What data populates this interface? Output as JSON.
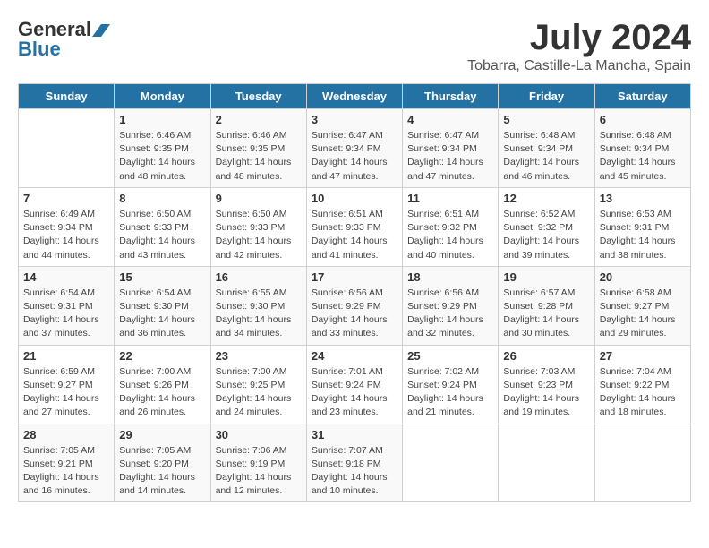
{
  "header": {
    "logo_general": "General",
    "logo_blue": "Blue",
    "month": "July 2024",
    "location": "Tobarra, Castille-La Mancha, Spain"
  },
  "weekdays": [
    "Sunday",
    "Monday",
    "Tuesday",
    "Wednesday",
    "Thursday",
    "Friday",
    "Saturday"
  ],
  "weeks": [
    [
      {
        "day": "",
        "sunrise": "",
        "sunset": "",
        "daylight": ""
      },
      {
        "day": "1",
        "sunrise": "Sunrise: 6:46 AM",
        "sunset": "Sunset: 9:35 PM",
        "daylight": "Daylight: 14 hours and 48 minutes."
      },
      {
        "day": "2",
        "sunrise": "Sunrise: 6:46 AM",
        "sunset": "Sunset: 9:35 PM",
        "daylight": "Daylight: 14 hours and 48 minutes."
      },
      {
        "day": "3",
        "sunrise": "Sunrise: 6:47 AM",
        "sunset": "Sunset: 9:34 PM",
        "daylight": "Daylight: 14 hours and 47 minutes."
      },
      {
        "day": "4",
        "sunrise": "Sunrise: 6:47 AM",
        "sunset": "Sunset: 9:34 PM",
        "daylight": "Daylight: 14 hours and 47 minutes."
      },
      {
        "day": "5",
        "sunrise": "Sunrise: 6:48 AM",
        "sunset": "Sunset: 9:34 PM",
        "daylight": "Daylight: 14 hours and 46 minutes."
      },
      {
        "day": "6",
        "sunrise": "Sunrise: 6:48 AM",
        "sunset": "Sunset: 9:34 PM",
        "daylight": "Daylight: 14 hours and 45 minutes."
      }
    ],
    [
      {
        "day": "7",
        "sunrise": "Sunrise: 6:49 AM",
        "sunset": "Sunset: 9:34 PM",
        "daylight": "Daylight: 14 hours and 44 minutes."
      },
      {
        "day": "8",
        "sunrise": "Sunrise: 6:50 AM",
        "sunset": "Sunset: 9:33 PM",
        "daylight": "Daylight: 14 hours and 43 minutes."
      },
      {
        "day": "9",
        "sunrise": "Sunrise: 6:50 AM",
        "sunset": "Sunset: 9:33 PM",
        "daylight": "Daylight: 14 hours and 42 minutes."
      },
      {
        "day": "10",
        "sunrise": "Sunrise: 6:51 AM",
        "sunset": "Sunset: 9:33 PM",
        "daylight": "Daylight: 14 hours and 41 minutes."
      },
      {
        "day": "11",
        "sunrise": "Sunrise: 6:51 AM",
        "sunset": "Sunset: 9:32 PM",
        "daylight": "Daylight: 14 hours and 40 minutes."
      },
      {
        "day": "12",
        "sunrise": "Sunrise: 6:52 AM",
        "sunset": "Sunset: 9:32 PM",
        "daylight": "Daylight: 14 hours and 39 minutes."
      },
      {
        "day": "13",
        "sunrise": "Sunrise: 6:53 AM",
        "sunset": "Sunset: 9:31 PM",
        "daylight": "Daylight: 14 hours and 38 minutes."
      }
    ],
    [
      {
        "day": "14",
        "sunrise": "Sunrise: 6:54 AM",
        "sunset": "Sunset: 9:31 PM",
        "daylight": "Daylight: 14 hours and 37 minutes."
      },
      {
        "day": "15",
        "sunrise": "Sunrise: 6:54 AM",
        "sunset": "Sunset: 9:30 PM",
        "daylight": "Daylight: 14 hours and 36 minutes."
      },
      {
        "day": "16",
        "sunrise": "Sunrise: 6:55 AM",
        "sunset": "Sunset: 9:30 PM",
        "daylight": "Daylight: 14 hours and 34 minutes."
      },
      {
        "day": "17",
        "sunrise": "Sunrise: 6:56 AM",
        "sunset": "Sunset: 9:29 PM",
        "daylight": "Daylight: 14 hours and 33 minutes."
      },
      {
        "day": "18",
        "sunrise": "Sunrise: 6:56 AM",
        "sunset": "Sunset: 9:29 PM",
        "daylight": "Daylight: 14 hours and 32 minutes."
      },
      {
        "day": "19",
        "sunrise": "Sunrise: 6:57 AM",
        "sunset": "Sunset: 9:28 PM",
        "daylight": "Daylight: 14 hours and 30 minutes."
      },
      {
        "day": "20",
        "sunrise": "Sunrise: 6:58 AM",
        "sunset": "Sunset: 9:27 PM",
        "daylight": "Daylight: 14 hours and 29 minutes."
      }
    ],
    [
      {
        "day": "21",
        "sunrise": "Sunrise: 6:59 AM",
        "sunset": "Sunset: 9:27 PM",
        "daylight": "Daylight: 14 hours and 27 minutes."
      },
      {
        "day": "22",
        "sunrise": "Sunrise: 7:00 AM",
        "sunset": "Sunset: 9:26 PM",
        "daylight": "Daylight: 14 hours and 26 minutes."
      },
      {
        "day": "23",
        "sunrise": "Sunrise: 7:00 AM",
        "sunset": "Sunset: 9:25 PM",
        "daylight": "Daylight: 14 hours and 24 minutes."
      },
      {
        "day": "24",
        "sunrise": "Sunrise: 7:01 AM",
        "sunset": "Sunset: 9:24 PM",
        "daylight": "Daylight: 14 hours and 23 minutes."
      },
      {
        "day": "25",
        "sunrise": "Sunrise: 7:02 AM",
        "sunset": "Sunset: 9:24 PM",
        "daylight": "Daylight: 14 hours and 21 minutes."
      },
      {
        "day": "26",
        "sunrise": "Sunrise: 7:03 AM",
        "sunset": "Sunset: 9:23 PM",
        "daylight": "Daylight: 14 hours and 19 minutes."
      },
      {
        "day": "27",
        "sunrise": "Sunrise: 7:04 AM",
        "sunset": "Sunset: 9:22 PM",
        "daylight": "Daylight: 14 hours and 18 minutes."
      }
    ],
    [
      {
        "day": "28",
        "sunrise": "Sunrise: 7:05 AM",
        "sunset": "Sunset: 9:21 PM",
        "daylight": "Daylight: 14 hours and 16 minutes."
      },
      {
        "day": "29",
        "sunrise": "Sunrise: 7:05 AM",
        "sunset": "Sunset: 9:20 PM",
        "daylight": "Daylight: 14 hours and 14 minutes."
      },
      {
        "day": "30",
        "sunrise": "Sunrise: 7:06 AM",
        "sunset": "Sunset: 9:19 PM",
        "daylight": "Daylight: 14 hours and 12 minutes."
      },
      {
        "day": "31",
        "sunrise": "Sunrise: 7:07 AM",
        "sunset": "Sunset: 9:18 PM",
        "daylight": "Daylight: 14 hours and 10 minutes."
      },
      {
        "day": "",
        "sunrise": "",
        "sunset": "",
        "daylight": ""
      },
      {
        "day": "",
        "sunrise": "",
        "sunset": "",
        "daylight": ""
      },
      {
        "day": "",
        "sunrise": "",
        "sunset": "",
        "daylight": ""
      }
    ]
  ]
}
